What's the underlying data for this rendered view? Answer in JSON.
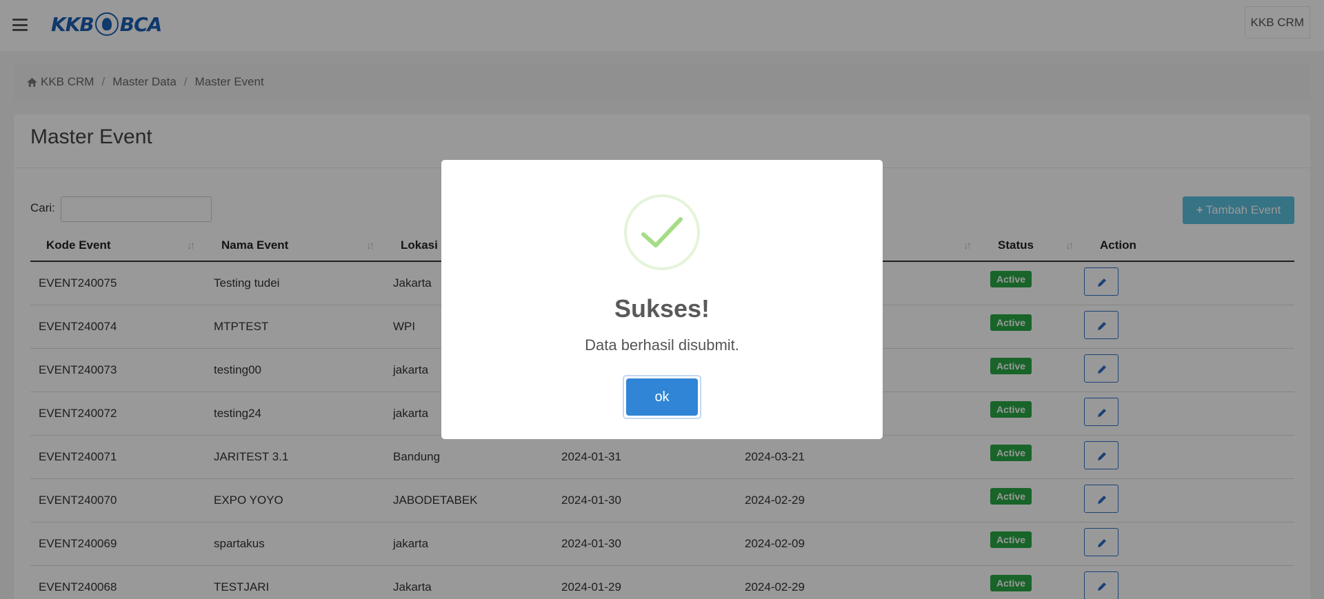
{
  "header": {
    "logo_left": "KKB",
    "logo_right": "BCA",
    "user_label": "KKB CRM"
  },
  "breadcrumb": {
    "items": [
      "KKB CRM",
      "Master Data",
      "Master Event"
    ]
  },
  "page": {
    "title": "Master Event",
    "search_label": "Cari:",
    "search_value": "",
    "add_button_label": "Tambah Event"
  },
  "table": {
    "columns": [
      "Kode Event",
      "Nama Event",
      "Lokasi",
      "",
      "",
      "Status",
      "Action"
    ],
    "rows": [
      {
        "kode": "EVENT240075",
        "nama": "Testing tudei",
        "lokasi": "Jakarta",
        "start": "",
        "end": "",
        "status": "Active"
      },
      {
        "kode": "EVENT240074",
        "nama": "MTPTEST",
        "lokasi": "WPI",
        "start": "",
        "end": "",
        "status": "Active"
      },
      {
        "kode": "EVENT240073",
        "nama": "testing00",
        "lokasi": "jakarta",
        "start": "",
        "end": "",
        "status": "Active"
      },
      {
        "kode": "EVENT240072",
        "nama": "testing24",
        "lokasi": "jakarta",
        "start": "",
        "end": "",
        "status": "Active"
      },
      {
        "kode": "EVENT240071",
        "nama": "JARITEST 3.1",
        "lokasi": "Bandung",
        "start": "2024-01-31",
        "end": "2024-03-21",
        "status": "Active"
      },
      {
        "kode": "EVENT240070",
        "nama": "EXPO YOYO",
        "lokasi": "JABODETABEK",
        "start": "2024-01-30",
        "end": "2024-02-29",
        "status": "Active"
      },
      {
        "kode": "EVENT240069",
        "nama": "spartakus",
        "lokasi": "jakarta",
        "start": "2024-01-30",
        "end": "2024-02-09",
        "status": "Active"
      },
      {
        "kode": "EVENT240068",
        "nama": "TESTJARI",
        "lokasi": "Jakarta",
        "start": "2024-01-29",
        "end": "2024-02-29",
        "status": "Active"
      }
    ]
  },
  "modal": {
    "icon": "success-check-icon",
    "title": "Sukses!",
    "text": "Data berhasil disubmit.",
    "ok_label": "ok"
  },
  "colors": {
    "brand": "#1b5fb5",
    "active_badge": "#28a745",
    "add_button": "#5bc0de",
    "ok_button": "#3085d6",
    "success_check": "#a5dc86"
  }
}
